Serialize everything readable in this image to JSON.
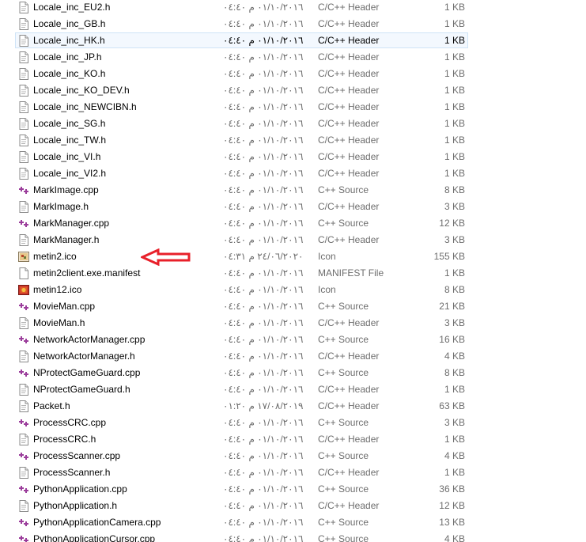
{
  "rows": [
    {
      "name": "Locale_inc_EU2.h",
      "date": "٠١/١٠/٢٠١٦ م ٠٤:٤٠",
      "type": "C/C++ Header",
      "size": "1 KB",
      "icon": "h-file-icon"
    },
    {
      "name": "Locale_inc_GB.h",
      "date": "٠١/١٠/٢٠١٦ م ٠٤:٤٠",
      "type": "C/C++ Header",
      "size": "1 KB",
      "icon": "h-file-icon"
    },
    {
      "name": "Locale_inc_HK.h",
      "date": "٠١/١٠/٢٠١٦ م ٠٤:٤٠",
      "type": "C/C++ Header",
      "size": "1 KB",
      "icon": "h-file-icon",
      "selected": true
    },
    {
      "name": "Locale_inc_JP.h",
      "date": "٠١/١٠/٢٠١٦ م ٠٤:٤٠",
      "type": "C/C++ Header",
      "size": "1 KB",
      "icon": "h-file-icon"
    },
    {
      "name": "Locale_inc_KO.h",
      "date": "٠١/١٠/٢٠١٦ م ٠٤:٤٠",
      "type": "C/C++ Header",
      "size": "1 KB",
      "icon": "h-file-icon"
    },
    {
      "name": "Locale_inc_KO_DEV.h",
      "date": "٠١/١٠/٢٠١٦ م ٠٤:٤٠",
      "type": "C/C++ Header",
      "size": "1 KB",
      "icon": "h-file-icon"
    },
    {
      "name": "Locale_inc_NEWCIBN.h",
      "date": "٠١/١٠/٢٠١٦ م ٠٤:٤٠",
      "type": "C/C++ Header",
      "size": "1 KB",
      "icon": "h-file-icon"
    },
    {
      "name": "Locale_inc_SG.h",
      "date": "٠١/١٠/٢٠١٦ م ٠٤:٤٠",
      "type": "C/C++ Header",
      "size": "1 KB",
      "icon": "h-file-icon"
    },
    {
      "name": "Locale_inc_TW.h",
      "date": "٠١/١٠/٢٠١٦ م ٠٤:٤٠",
      "type": "C/C++ Header",
      "size": "1 KB",
      "icon": "h-file-icon"
    },
    {
      "name": "Locale_inc_VI.h",
      "date": "٠١/١٠/٢٠١٦ م ٠٤:٤٠",
      "type": "C/C++ Header",
      "size": "1 KB",
      "icon": "h-file-icon"
    },
    {
      "name": "Locale_inc_VI2.h",
      "date": "٠١/١٠/٢٠١٦ م ٠٤:٤٠",
      "type": "C/C++ Header",
      "size": "1 KB",
      "icon": "h-file-icon"
    },
    {
      "name": "MarkImage.cpp",
      "date": "٠١/١٠/٢٠١٦ م ٠٤:٤٠",
      "type": "C++ Source",
      "size": "8 KB",
      "icon": "cpp-file-icon"
    },
    {
      "name": "MarkImage.h",
      "date": "٠١/١٠/٢٠١٦ م ٠٤:٤٠",
      "type": "C/C++ Header",
      "size": "3 KB",
      "icon": "h-file-icon"
    },
    {
      "name": "MarkManager.cpp",
      "date": "٠١/١٠/٢٠١٦ م ٠٤:٤٠",
      "type": "C++ Source",
      "size": "12 KB",
      "icon": "cpp-file-icon"
    },
    {
      "name": "MarkManager.h",
      "date": "٠١/١٠/٢٠١٦ م ٠٤:٤٠",
      "type": "C/C++ Header",
      "size": "3 KB",
      "icon": "h-file-icon"
    },
    {
      "name": "metin2.ico",
      "date": "٢٤/٠٦/٢٠٢٠ م ٠٤:٣١",
      "type": "Icon",
      "size": "155 KB",
      "icon": "ico-file-icon"
    },
    {
      "name": "metin2client.exe.manifest",
      "date": "٠١/١٠/٢٠١٦ م ٠٤:٤٠",
      "type": "MANIFEST File",
      "size": "1 KB",
      "icon": "blank-file-icon"
    },
    {
      "name": "metin12.ico",
      "date": "٠١/١٠/٢٠١٦ م ٠٤:٤٠",
      "type": "Icon",
      "size": "8 KB",
      "icon": "red-ico-file-icon"
    },
    {
      "name": "MovieMan.cpp",
      "date": "٠١/١٠/٢٠١٦ م ٠٤:٤٠",
      "type": "C++ Source",
      "size": "21 KB",
      "icon": "cpp-file-icon"
    },
    {
      "name": "MovieMan.h",
      "date": "٠١/١٠/٢٠١٦ م ٠٤:٤٠",
      "type": "C/C++ Header",
      "size": "3 KB",
      "icon": "h-file-icon"
    },
    {
      "name": "NetworkActorManager.cpp",
      "date": "٠١/١٠/٢٠١٦ م ٠٤:٤٠",
      "type": "C++ Source",
      "size": "16 KB",
      "icon": "cpp-file-icon"
    },
    {
      "name": "NetworkActorManager.h",
      "date": "٠١/١٠/٢٠١٦ م ٠٤:٤٠",
      "type": "C/C++ Header",
      "size": "4 KB",
      "icon": "h-file-icon"
    },
    {
      "name": "NProtectGameGuard.cpp",
      "date": "٠١/١٠/٢٠١٦ م ٠٤:٤٠",
      "type": "C++ Source",
      "size": "8 KB",
      "icon": "cpp-file-icon"
    },
    {
      "name": "NProtectGameGuard.h",
      "date": "٠١/١٠/٢٠١٦ م ٠٤:٤٠",
      "type": "C/C++ Header",
      "size": "1 KB",
      "icon": "h-file-icon"
    },
    {
      "name": "Packet.h",
      "date": "١٧/٠٨/٢٠١٩ م ٠١:٢٠",
      "type": "C/C++ Header",
      "size": "63 KB",
      "icon": "h-file-icon"
    },
    {
      "name": "ProcessCRC.cpp",
      "date": "٠١/١٠/٢٠١٦ م ٠٤:٤٠",
      "type": "C++ Source",
      "size": "3 KB",
      "icon": "cpp-file-icon"
    },
    {
      "name": "ProcessCRC.h",
      "date": "٠١/١٠/٢٠١٦ م ٠٤:٤٠",
      "type": "C/C++ Header",
      "size": "1 KB",
      "icon": "h-file-icon"
    },
    {
      "name": "ProcessScanner.cpp",
      "date": "٠١/١٠/٢٠١٦ م ٠٤:٤٠",
      "type": "C++ Source",
      "size": "4 KB",
      "icon": "cpp-file-icon"
    },
    {
      "name": "ProcessScanner.h",
      "date": "٠١/١٠/٢٠١٦ م ٠٤:٤٠",
      "type": "C/C++ Header",
      "size": "1 KB",
      "icon": "h-file-icon"
    },
    {
      "name": "PythonApplication.cpp",
      "date": "٠١/١٠/٢٠١٦ م ٠٤:٤٠",
      "type": "C++ Source",
      "size": "36 KB",
      "icon": "cpp-file-icon"
    },
    {
      "name": "PythonApplication.h",
      "date": "٠١/١٠/٢٠١٦ م ٠٤:٤٠",
      "type": "C/C++ Header",
      "size": "12 KB",
      "icon": "h-file-icon"
    },
    {
      "name": "PythonApplicationCamera.cpp",
      "date": "٠١/١٠/٢٠١٦ م ٠٤:٤٠",
      "type": "C++ Source",
      "size": "13 KB",
      "icon": "cpp-file-icon"
    },
    {
      "name": "PythonApplicationCursor.cpp",
      "date": "٠١/١٠/٢٠١٦ م ٠٤:٤٠",
      "type": "C++ Source",
      "size": "4 KB",
      "icon": "cpp-file-icon"
    }
  ],
  "annotation": {
    "icon": "red-arrow-left-icon",
    "color": "#e8202a"
  },
  "colors": {
    "cpp_accent": "#9b3d9b",
    "selection_bg": "#f3f8fe",
    "selection_border": "#cfe4f7",
    "detail_text": "#6d6d6d"
  }
}
